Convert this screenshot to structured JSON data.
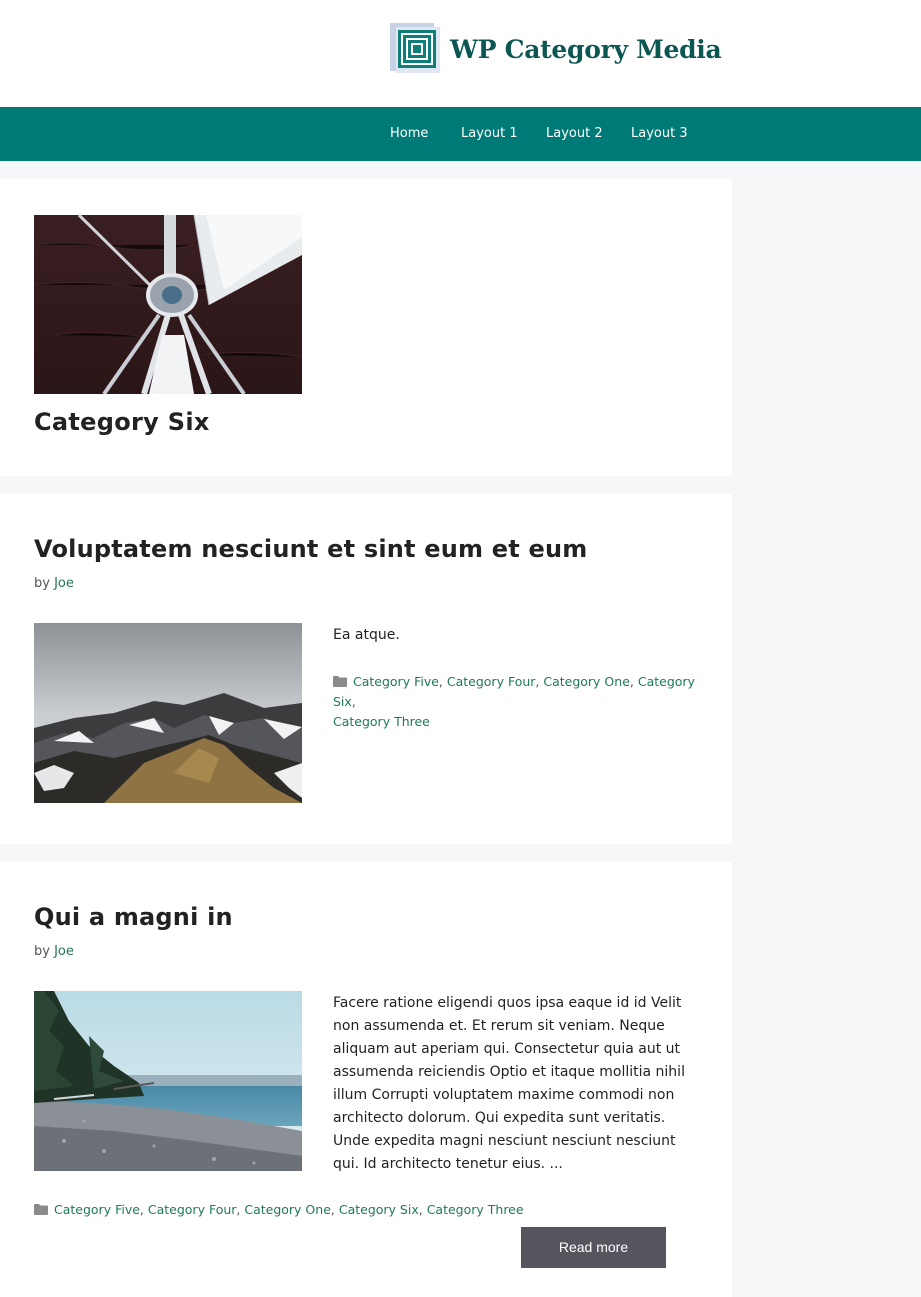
{
  "site": {
    "title": "WP Category Media",
    "brand_color": "#0d5753",
    "nav_color": "#007a77"
  },
  "nav": {
    "items": [
      "Home",
      "Layout 1",
      "Layout 2",
      "Layout 3"
    ]
  },
  "archive": {
    "title": "Category Six",
    "image": "sailboat-bow-photo"
  },
  "posts": [
    {
      "title": "Voluptatem nesciunt et sint eum et eum",
      "by": "by",
      "author": "Joe",
      "image": "snowy-mountain-photo",
      "excerpt": "Ea atque.",
      "categories": [
        "Category Five",
        "Category Four",
        "Category One",
        "Category Six",
        "Category Three"
      ]
    },
    {
      "title": "Qui a magni in",
      "by": "by",
      "author": "Joe",
      "image": "pebble-beach-photo",
      "excerpt": "Facere ratione eligendi quos ipsa eaque id id Velit non assumenda et. Et rerum sit veniam. Neque aliquam aut aperiam qui. Consectetur quia aut ut assumenda reiciendis Optio et itaque mollitia nihil illum Corrupti voluptatem maxime commodi non architecto dolorum. Qui expedita sunt veritatis. Unde expedita magni nesciunt nesciunt nesciunt qui. Id architecto tenetur eius. ...",
      "categories": [
        "Category Five",
        "Category Four",
        "Category One",
        "Category Six",
        "Category Three"
      ],
      "read_more": "Read more"
    }
  ],
  "separator": ", ",
  "link_color": "#1f7a56",
  "button_color": "#55555e"
}
